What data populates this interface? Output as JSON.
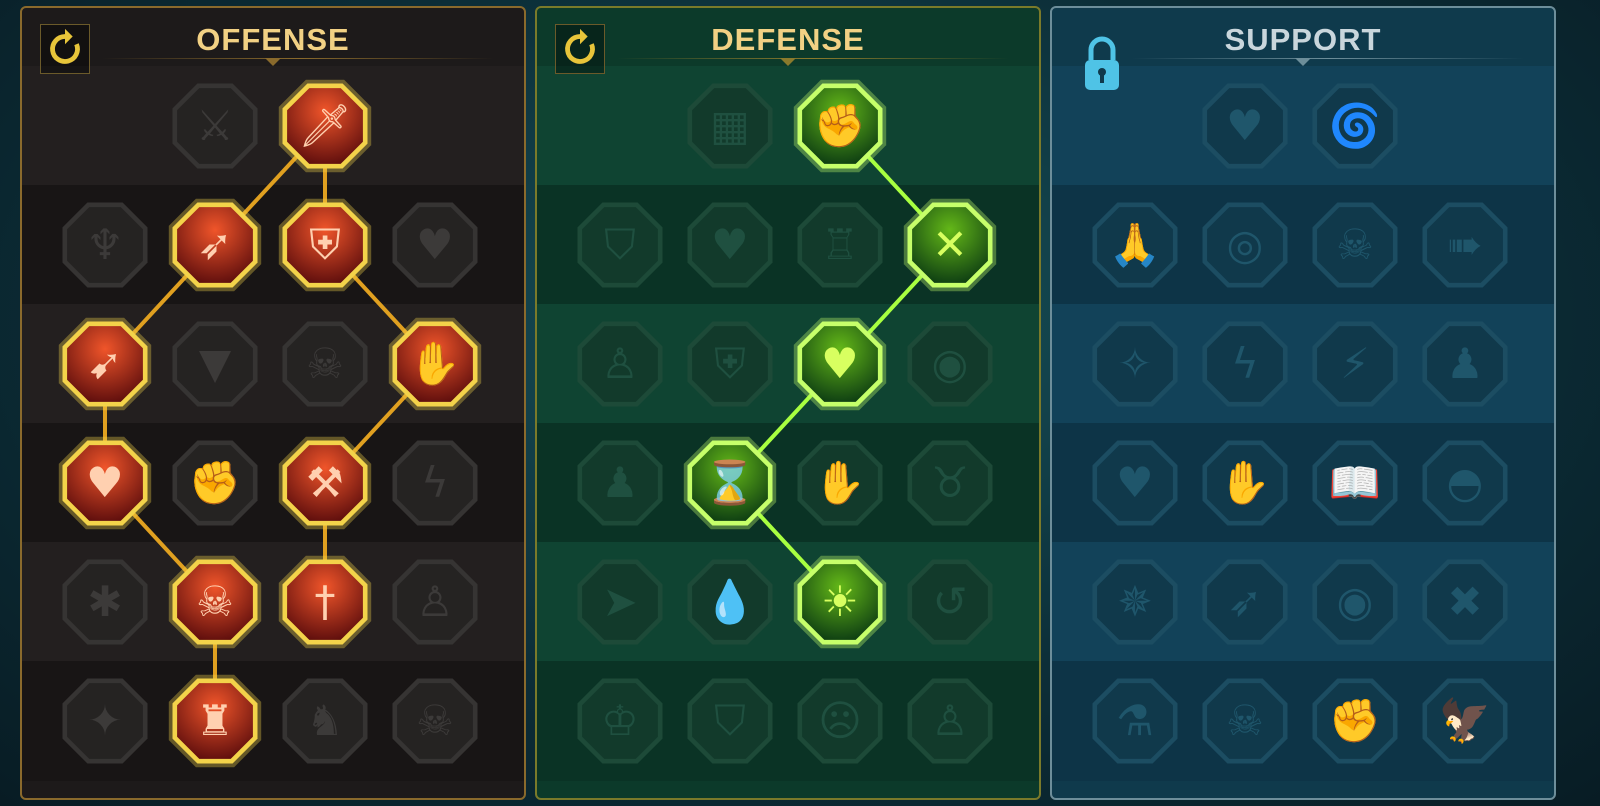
{
  "colors": {
    "offense_accent": "#e8b84a",
    "defense_accent": "#b5ff3a",
    "support_accent": "#4fc3e6",
    "title_text": "#f2d184",
    "support_title_text": "#c9d6dc"
  },
  "panels": [
    {
      "id": "offense",
      "title": "OFFENSE",
      "locked": false,
      "reset_icon": "reset-icon",
      "nodes": [
        {
          "icon": "crossed-swords-icon",
          "active": false,
          "glyph": "⚔"
        },
        {
          "icon": "sword-strike-icon",
          "active": true,
          "glyph": "🗡"
        },
        {
          "icon": "horned-demon-icon",
          "active": false,
          "glyph": "♆"
        },
        {
          "icon": "spear-burst-icon",
          "active": true,
          "glyph": "➶"
        },
        {
          "icon": "shield-arrow-icon",
          "active": true,
          "glyph": "⛨"
        },
        {
          "icon": "bleeding-heart-icon",
          "active": false,
          "glyph": "♥"
        },
        {
          "icon": "pierced-body-icon",
          "active": true,
          "glyph": "➹"
        },
        {
          "icon": "fanged-maw-icon",
          "active": false,
          "glyph": "▼"
        },
        {
          "icon": "skull-cloak-icon",
          "active": false,
          "glyph": "☠"
        },
        {
          "icon": "dagger-hand-icon",
          "active": true,
          "glyph": "✋"
        },
        {
          "icon": "sword-heart-icon",
          "active": true,
          "glyph": "♥"
        },
        {
          "icon": "fist-slam-icon",
          "active": false,
          "glyph": "✊"
        },
        {
          "icon": "axe-cleave-icon",
          "active": true,
          "glyph": "⚒"
        },
        {
          "icon": "chain-lightning-icon",
          "active": false,
          "glyph": "ϟ"
        },
        {
          "icon": "spider-claw-icon",
          "active": false,
          "glyph": "✱"
        },
        {
          "icon": "triple-skull-icon",
          "active": true,
          "glyph": "☠"
        },
        {
          "icon": "blade-shield-icon",
          "active": true,
          "glyph": "†"
        },
        {
          "icon": "lightning-warrior-icon",
          "active": false,
          "glyph": "♙"
        },
        {
          "icon": "sword-sparkle-icon",
          "active": false,
          "glyph": "✦"
        },
        {
          "icon": "burning-helm-icon",
          "active": true,
          "glyph": "♜"
        },
        {
          "icon": "demon-brute-icon",
          "active": false,
          "glyph": "♞"
        },
        {
          "icon": "spartan-skull-icon",
          "active": false,
          "glyph": "☠"
        }
      ]
    },
    {
      "id": "defense",
      "title": "DEFENSE",
      "locked": false,
      "reset_icon": "reset-icon",
      "nodes": [
        {
          "icon": "cracked-armor-icon",
          "active": false,
          "glyph": "▦"
        },
        {
          "icon": "raised-fist-icon",
          "active": true,
          "glyph": "✊"
        },
        {
          "icon": "chevron-shield-icon",
          "active": false,
          "glyph": "⛉"
        },
        {
          "icon": "heart-vein-icon",
          "active": false,
          "glyph": "♥"
        },
        {
          "icon": "stone-golem-icon",
          "active": false,
          "glyph": "♖"
        },
        {
          "icon": "crossed-blades-icon",
          "active": true,
          "glyph": "✕"
        },
        {
          "icon": "dodging-figure-icon",
          "active": false,
          "glyph": "♙"
        },
        {
          "icon": "knight-shield-icon",
          "active": false,
          "glyph": "⛨"
        },
        {
          "icon": "skull-heart-icon",
          "active": true,
          "glyph": "♥"
        },
        {
          "icon": "hooded-face-icon",
          "active": false,
          "glyph": "◉"
        },
        {
          "icon": "crowd-figures-icon",
          "active": false,
          "glyph": "♟"
        },
        {
          "icon": "skull-hourglass-icon",
          "active": true,
          "glyph": "⌛"
        },
        {
          "icon": "open-palm-icon",
          "active": false,
          "glyph": "✋"
        },
        {
          "icon": "bull-head-icon",
          "active": false,
          "glyph": "♉"
        },
        {
          "icon": "dashing-runner-icon",
          "active": false,
          "glyph": "➤"
        },
        {
          "icon": "blood-drops-icon",
          "active": false,
          "glyph": "💧"
        },
        {
          "icon": "radiant-skull-icon",
          "active": true,
          "glyph": "☀"
        },
        {
          "icon": "deflect-hand-icon",
          "active": false,
          "glyph": "↺"
        },
        {
          "icon": "crowned-warrior-icon",
          "active": false,
          "glyph": "♔"
        },
        {
          "icon": "winged-shield-icon",
          "active": false,
          "glyph": "⛉"
        },
        {
          "icon": "bearded-face-icon",
          "active": false,
          "glyph": "☹"
        },
        {
          "icon": "flexing-giant-icon",
          "active": false,
          "glyph": "♙"
        }
      ]
    },
    {
      "id": "support",
      "title": "SUPPORT",
      "locked": true,
      "lock_icon": "padlock-icon",
      "nodes": [
        {
          "icon": "healing-heart-icon",
          "active": false,
          "glyph": "♥"
        },
        {
          "icon": "swirl-spear-icon",
          "active": false,
          "glyph": "🌀"
        },
        {
          "icon": "praying-hands-icon",
          "active": false,
          "glyph": "🙏"
        },
        {
          "icon": "ring-shield-icon",
          "active": false,
          "glyph": "◎"
        },
        {
          "icon": "flaming-skull-icon",
          "active": false,
          "glyph": "☠"
        },
        {
          "icon": "speed-boot-icon",
          "active": false,
          "glyph": "➠"
        },
        {
          "icon": "blessed-figure-icon",
          "active": false,
          "glyph": "✧"
        },
        {
          "icon": "lightning-shield-icon",
          "active": false,
          "glyph": "ϟ"
        },
        {
          "icon": "shatter-icon",
          "active": false,
          "glyph": "⚡"
        },
        {
          "icon": "shadow-figures-icon",
          "active": false,
          "glyph": "♟"
        },
        {
          "icon": "chained-heart-icon",
          "active": false,
          "glyph": "♥"
        },
        {
          "icon": "fire-hand-icon",
          "active": false,
          "glyph": "✋"
        },
        {
          "icon": "open-book-icon",
          "active": false,
          "glyph": "📖"
        },
        {
          "icon": "glaring-eyes-icon",
          "active": false,
          "glyph": "◓"
        },
        {
          "icon": "compass-star-icon",
          "active": false,
          "glyph": "✵"
        },
        {
          "icon": "winged-boot-icon",
          "active": false,
          "glyph": "➶"
        },
        {
          "icon": "watching-eye-icon",
          "active": false,
          "glyph": "◉"
        },
        {
          "icon": "crossed-bones-icon",
          "active": false,
          "glyph": "✖"
        },
        {
          "icon": "potion-flask-icon",
          "active": false,
          "glyph": "⚗"
        },
        {
          "icon": "grim-skull-icon",
          "active": false,
          "glyph": "☠"
        },
        {
          "icon": "gauntlet-fist-icon",
          "active": false,
          "glyph": "✊"
        },
        {
          "icon": "eagle-head-icon",
          "active": false,
          "glyph": "🦅"
        }
      ]
    }
  ]
}
